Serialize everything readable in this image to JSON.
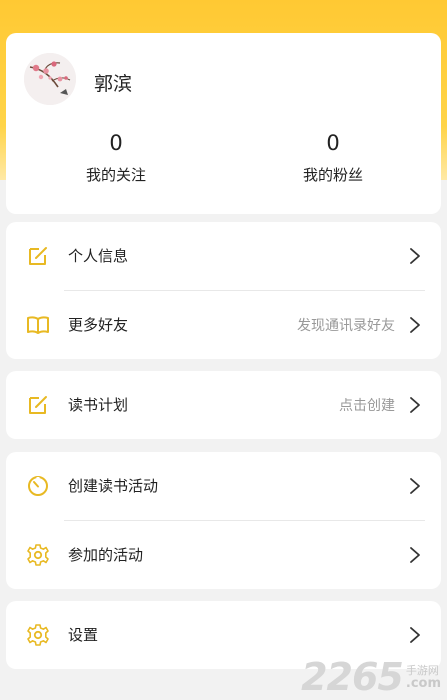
{
  "profile": {
    "name": "郭滨",
    "following_count": "0",
    "following_label": "我的关注",
    "fans_count": "0",
    "fans_label": "我的粉丝"
  },
  "menu": {
    "personal_info": "个人信息",
    "more_friends": "更多好友",
    "more_friends_hint": "发现通讯录好友",
    "reading_plan": "读书计划",
    "reading_plan_hint": "点击创建",
    "create_activity": "创建读书活动",
    "joined_activities": "参加的活动",
    "settings": "设置"
  },
  "icons": {
    "personal_info": "edit-icon",
    "more_friends": "book-icon",
    "reading_plan": "edit-icon",
    "create_activity": "timer-icon",
    "joined_activities": "gear-icon",
    "settings": "gear-icon",
    "row_arrow": "chevron-right-icon"
  },
  "colors": {
    "accent": "#ffc933",
    "icon": "#e8b923",
    "hint_text": "#999999"
  },
  "watermark": {
    "number": "2265",
    "site_cn": "手游网",
    "site_com": ".com"
  }
}
